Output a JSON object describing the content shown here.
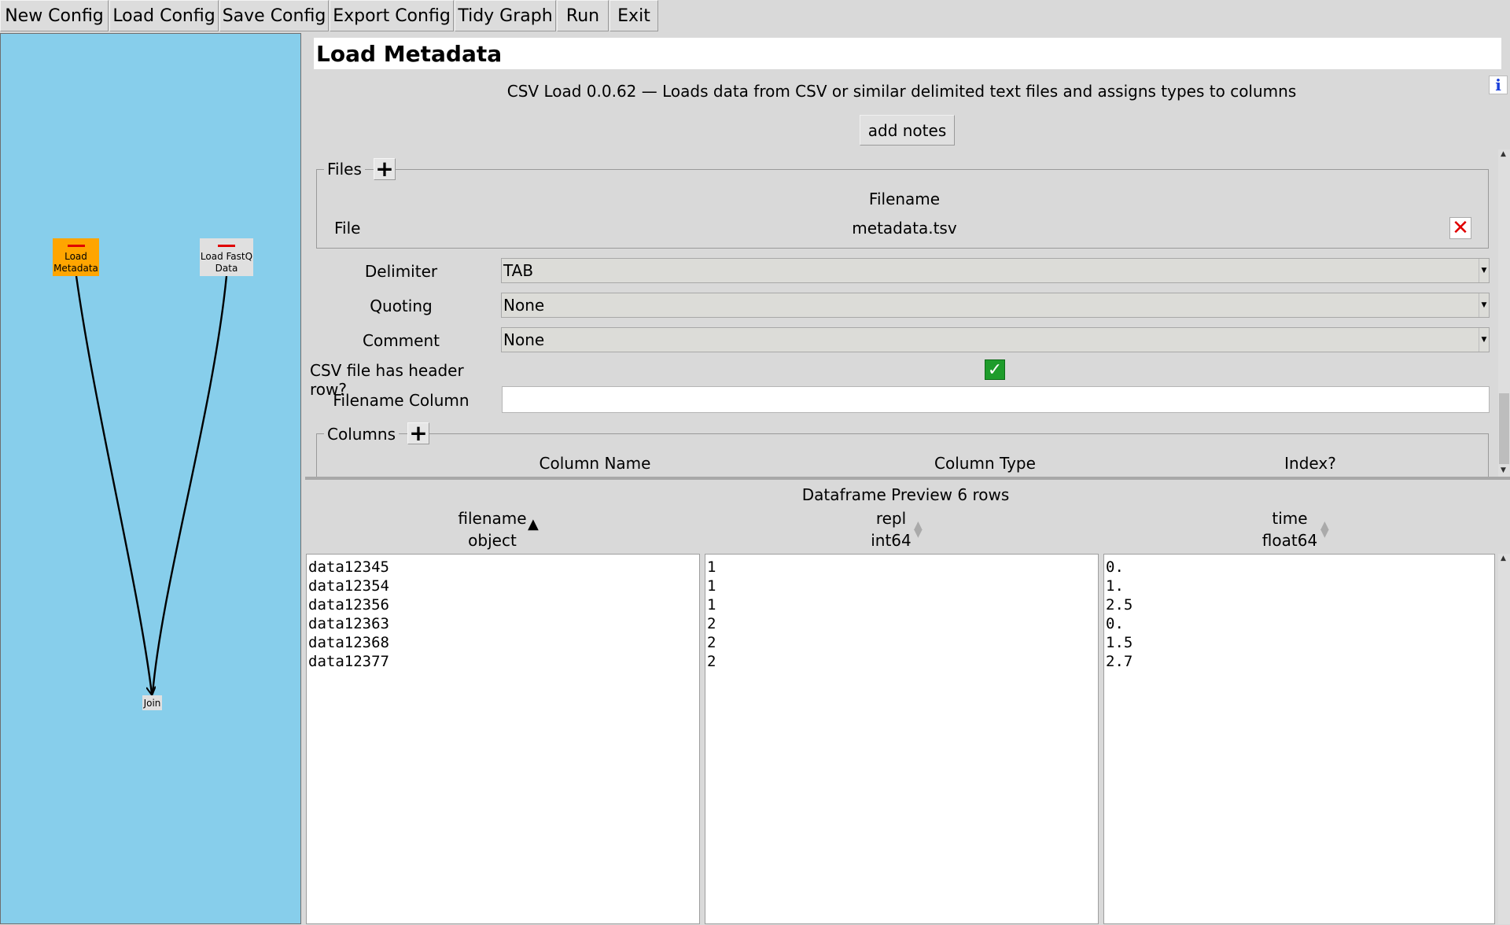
{
  "toolbar": {
    "buttons": [
      "New Config",
      "Load Config",
      "Save Config",
      "Export Config",
      "Tidy Graph",
      "Run",
      "Exit"
    ]
  },
  "graph": {
    "background": "#87ceeb",
    "nodes": [
      {
        "label_line1": "Load",
        "label_line2": "Metadata",
        "selected": true,
        "color": "#ffa500"
      },
      {
        "label_line1": "Load FastQ",
        "label_line2": "Data",
        "selected": false,
        "color": "#e0e0e0"
      },
      {
        "label": "Join"
      }
    ]
  },
  "panel": {
    "title": "Load Metadata",
    "info_icon": "i",
    "description": "CSV Load 0.0.62 — Loads data from CSV or similar delimited text files and assigns types to columns",
    "add_notes_label": "add notes",
    "files": {
      "legend": "Files",
      "header": "Filename",
      "row_label": "File",
      "filename": "metadata.tsv"
    },
    "delimiter": {
      "label": "Delimiter",
      "value": "TAB"
    },
    "quoting": {
      "label": "Quoting",
      "value": "None"
    },
    "comment": {
      "label": "Comment",
      "value": "None"
    },
    "header_row": {
      "label": "CSV file has header row?",
      "checked": true
    },
    "filename_column": {
      "label": "Filename Column",
      "value": ""
    },
    "columns": {
      "legend": "Columns",
      "headers": [
        "Column Name",
        "Column Type",
        "Index?"
      ]
    }
  },
  "preview": {
    "title": "Dataframe Preview 6 rows",
    "columns": [
      {
        "name": "filename",
        "dtype": "object",
        "sort": "ascending",
        "values": [
          "data12345",
          "data12354",
          "data12356",
          "data12363",
          "data12368",
          "data12377"
        ]
      },
      {
        "name": "repl",
        "dtype": "int64",
        "sort": "none",
        "values": [
          "1",
          "1",
          "1",
          "2",
          "2",
          "2"
        ]
      },
      {
        "name": "time",
        "dtype": "float64",
        "sort": "none",
        "values": [
          "0.",
          "1.",
          "2.5",
          "0.",
          "1.5",
          "2.7"
        ]
      }
    ]
  }
}
